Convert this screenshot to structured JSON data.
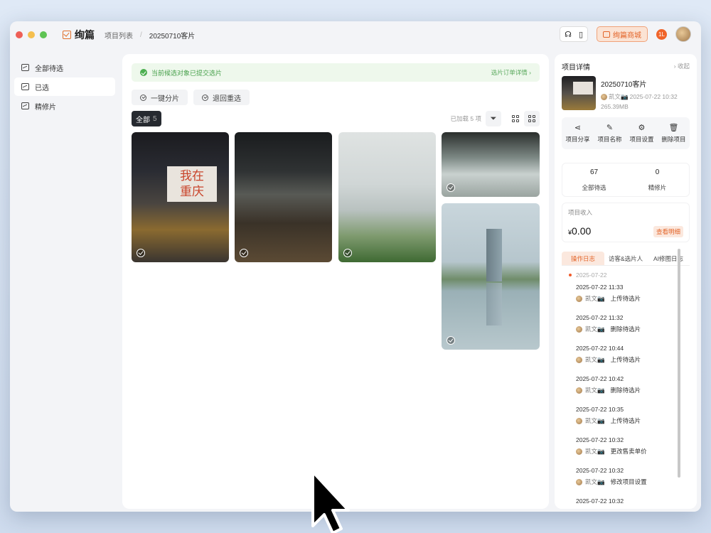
{
  "app": {
    "name": "绚篇"
  },
  "breadcrumb": {
    "root": "项目列表",
    "current": "20250710客片"
  },
  "titlebar": {
    "mall_label": "绚篇商城",
    "badge": "1L"
  },
  "sidebar": {
    "items": [
      {
        "label": "全部待选"
      },
      {
        "label": "已选"
      },
      {
        "label": "精修片"
      }
    ]
  },
  "main": {
    "notice": "当前候选对象已提交选片",
    "notice_link": "选片订单详情 ›",
    "actions": [
      {
        "label": "一键分片"
      },
      {
        "label": "退回重选"
      }
    ],
    "filter": {
      "all_label": "全部",
      "all_count": "5",
      "loaded": "已加载 5 项"
    },
    "photo_sign": "我在\n重庆"
  },
  "detail": {
    "title": "项目详情",
    "collapse": "› 收起",
    "project_name": "20250710客片",
    "owner": "凯文📷",
    "created": "2025-07-22 10:32",
    "size": "265.39MB",
    "ops": [
      {
        "label": "项目分享",
        "icon": "share-icon"
      },
      {
        "label": "项目名称",
        "icon": "edit-icon"
      },
      {
        "label": "项目设置",
        "icon": "gear-icon"
      },
      {
        "label": "删除项目",
        "icon": "trash-icon"
      }
    ],
    "stats": [
      {
        "value": "67",
        "label": "全部待选"
      },
      {
        "value": "0",
        "label": "精修片"
      }
    ],
    "income": {
      "label": "项目收入",
      "currency": "¥",
      "value": "0.00",
      "link": "查看明细"
    },
    "tabs": [
      {
        "label": "操作日志"
      },
      {
        "label": "访客&选片人"
      },
      {
        "label": "AI修图日志"
      }
    ],
    "log": {
      "date": "2025-07-22",
      "entries": [
        {
          "time": "2025-07-22 11:33",
          "user": "凯文📷",
          "action": "上传待选片"
        },
        {
          "time": "2025-07-22 11:32",
          "user": "凯文📷",
          "action": "删除待选片"
        },
        {
          "time": "2025-07-22 10:44",
          "user": "凯文📷",
          "action": "上传待选片"
        },
        {
          "time": "2025-07-22 10:42",
          "user": "凯文📷",
          "action": "删除待选片"
        },
        {
          "time": "2025-07-22 10:35",
          "user": "凯文📷",
          "action": "上传待选片"
        },
        {
          "time": "2025-07-22 10:32",
          "user": "凯文📷",
          "action": "更改售卖单价"
        },
        {
          "time": "2025-07-22 10:32",
          "user": "凯文📷",
          "action": "修改项目设置"
        },
        {
          "time": "2025-07-22 10:32",
          "user": "",
          "action": ""
        }
      ]
    }
  },
  "colors": {
    "accent": "#e3662b",
    "success": "#4caf50",
    "dark_tab": "#262a30"
  }
}
